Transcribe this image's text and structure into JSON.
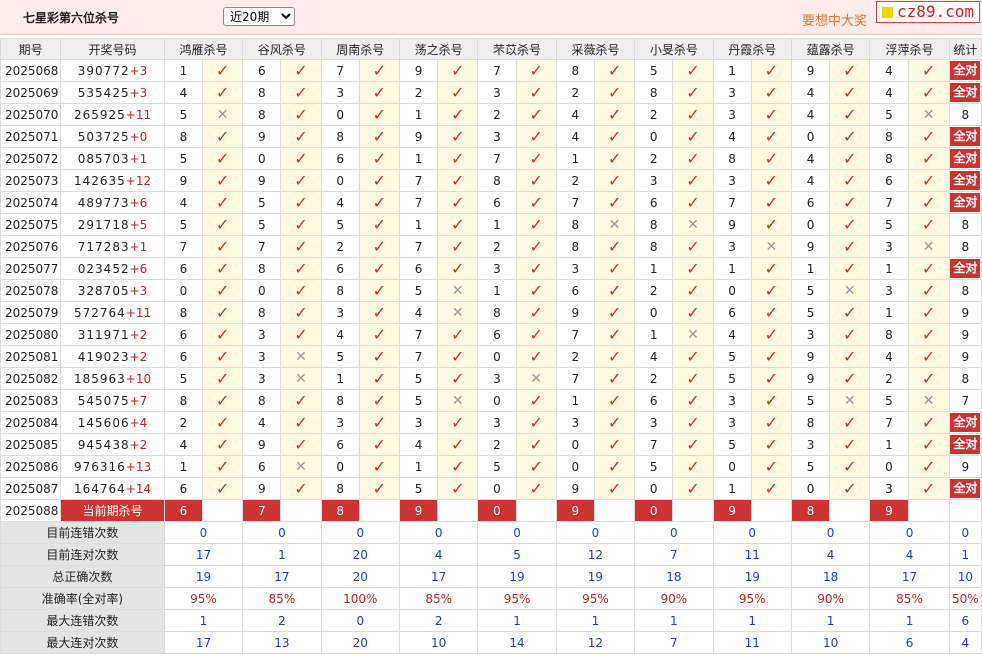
{
  "header": {
    "title": "七星彩第六位杀号",
    "period_select": "近20期",
    "slogan": "要想中大奖",
    "logo_text": "cz89.com"
  },
  "columns": {
    "period": "期号",
    "draw": "开奖号码",
    "experts": [
      "鸿雁杀号",
      "谷风杀号",
      "周南杀号",
      "荡之杀号",
      "芣苡杀号",
      "采薇杀号",
      "小旻杀号",
      "丹霞杀号",
      "蕴露杀号",
      "浮萍杀号"
    ],
    "stat": "统计"
  },
  "all_correct_label": "全对",
  "rows": [
    {
      "period": "2025068",
      "digits": "390772",
      "sum": "+3",
      "picks": [
        [
          1,
          1
        ],
        [
          6,
          1
        ],
        [
          7,
          1
        ],
        [
          9,
          1
        ],
        [
          7,
          1
        ],
        [
          8,
          1
        ],
        [
          5,
          1
        ],
        [
          1,
          1
        ],
        [
          9,
          1
        ],
        [
          4,
          1
        ]
      ],
      "stat": "全对"
    },
    {
      "period": "2025069",
      "digits": "535425",
      "sum": "+3",
      "picks": [
        [
          4,
          1
        ],
        [
          8,
          1
        ],
        [
          3,
          1
        ],
        [
          2,
          1
        ],
        [
          3,
          1
        ],
        [
          2,
          1
        ],
        [
          8,
          1
        ],
        [
          3,
          1
        ],
        [
          4,
          1
        ],
        [
          4,
          1
        ]
      ],
      "stat": "全对"
    },
    {
      "period": "2025070",
      "digits": "265925",
      "sum": "+11",
      "picks": [
        [
          5,
          0
        ],
        [
          8,
          1
        ],
        [
          0,
          1
        ],
        [
          1,
          1
        ],
        [
          2,
          1
        ],
        [
          4,
          1
        ],
        [
          2,
          1
        ],
        [
          3,
          1
        ],
        [
          4,
          1
        ],
        [
          5,
          0
        ]
      ],
      "stat": "8"
    },
    {
      "period": "2025071",
      "digits": "503725",
      "sum": "+0",
      "picks": [
        [
          8,
          1
        ],
        [
          9,
          1
        ],
        [
          8,
          1
        ],
        [
          9,
          1
        ],
        [
          3,
          1
        ],
        [
          4,
          1
        ],
        [
          0,
          1
        ],
        [
          4,
          1
        ],
        [
          0,
          1
        ],
        [
          8,
          1
        ]
      ],
      "stat": "全对"
    },
    {
      "period": "2025072",
      "digits": "085703",
      "sum": "+1",
      "picks": [
        [
          5,
          1
        ],
        [
          0,
          1
        ],
        [
          6,
          1
        ],
        [
          1,
          1
        ],
        [
          7,
          1
        ],
        [
          1,
          1
        ],
        [
          2,
          1
        ],
        [
          8,
          1
        ],
        [
          4,
          1
        ],
        [
          8,
          1
        ]
      ],
      "stat": "全对"
    },
    {
      "period": "2025073",
      "digits": "142635",
      "sum": "+12",
      "picks": [
        [
          9,
          1
        ],
        [
          9,
          1
        ],
        [
          0,
          1
        ],
        [
          7,
          1
        ],
        [
          8,
          1
        ],
        [
          2,
          1
        ],
        [
          3,
          1
        ],
        [
          3,
          1
        ],
        [
          4,
          1
        ],
        [
          6,
          1
        ]
      ],
      "stat": "全对"
    },
    {
      "period": "2025074",
      "digits": "489773",
      "sum": "+6",
      "picks": [
        [
          4,
          1
        ],
        [
          5,
          1
        ],
        [
          4,
          1
        ],
        [
          7,
          1
        ],
        [
          6,
          1
        ],
        [
          7,
          1
        ],
        [
          6,
          1
        ],
        [
          7,
          1
        ],
        [
          6,
          1
        ],
        [
          7,
          1
        ]
      ],
      "stat": "全对"
    },
    {
      "period": "2025075",
      "digits": "291718",
      "sum": "+5",
      "picks": [
        [
          5,
          1
        ],
        [
          5,
          1
        ],
        [
          5,
          1
        ],
        [
          1,
          1
        ],
        [
          1,
          1
        ],
        [
          8,
          0
        ],
        [
          8,
          0
        ],
        [
          9,
          1
        ],
        [
          0,
          1
        ],
        [
          5,
          1
        ]
      ],
      "stat": "8"
    },
    {
      "period": "2025076",
      "digits": "717283",
      "sum": "+1",
      "picks": [
        [
          7,
          1
        ],
        [
          7,
          1
        ],
        [
          2,
          1
        ],
        [
          7,
          1
        ],
        [
          2,
          1
        ],
        [
          8,
          1
        ],
        [
          8,
          1
        ],
        [
          3,
          0
        ],
        [
          9,
          1
        ],
        [
          3,
          0
        ]
      ],
      "stat": "8"
    },
    {
      "period": "2025077",
      "digits": "023452",
      "sum": "+6",
      "picks": [
        [
          6,
          1
        ],
        [
          8,
          1
        ],
        [
          6,
          1
        ],
        [
          6,
          1
        ],
        [
          3,
          1
        ],
        [
          3,
          1
        ],
        [
          1,
          1
        ],
        [
          1,
          1
        ],
        [
          1,
          1
        ],
        [
          1,
          1
        ]
      ],
      "stat": "全对"
    },
    {
      "period": "2025078",
      "digits": "328705",
      "sum": "+3",
      "picks": [
        [
          0,
          1
        ],
        [
          0,
          1
        ],
        [
          8,
          1
        ],
        [
          5,
          0
        ],
        [
          1,
          1
        ],
        [
          6,
          1
        ],
        [
          2,
          1
        ],
        [
          0,
          1
        ],
        [
          5,
          0
        ],
        [
          3,
          1
        ]
      ],
      "stat": "8"
    },
    {
      "period": "2025079",
      "digits": "572764",
      "sum": "+11",
      "picks": [
        [
          8,
          1
        ],
        [
          8,
          1
        ],
        [
          3,
          1
        ],
        [
          4,
          0
        ],
        [
          8,
          1
        ],
        [
          9,
          1
        ],
        [
          0,
          1
        ],
        [
          6,
          1
        ],
        [
          5,
          1
        ],
        [
          1,
          1
        ]
      ],
      "stat": "9"
    },
    {
      "period": "2025080",
      "digits": "311971",
      "sum": "+2",
      "picks": [
        [
          6,
          1
        ],
        [
          3,
          1
        ],
        [
          4,
          1
        ],
        [
          7,
          1
        ],
        [
          6,
          1
        ],
        [
          7,
          1
        ],
        [
          1,
          0
        ],
        [
          4,
          1
        ],
        [
          3,
          1
        ],
        [
          8,
          1
        ]
      ],
      "stat": "9"
    },
    {
      "period": "2025081",
      "digits": "419023",
      "sum": "+2",
      "picks": [
        [
          6,
          1
        ],
        [
          3,
          0
        ],
        [
          5,
          1
        ],
        [
          7,
          1
        ],
        [
          0,
          1
        ],
        [
          2,
          1
        ],
        [
          4,
          1
        ],
        [
          5,
          1
        ],
        [
          9,
          1
        ],
        [
          4,
          1
        ]
      ],
      "stat": "9"
    },
    {
      "period": "2025082",
      "digits": "185963",
      "sum": "+10",
      "picks": [
        [
          5,
          1
        ],
        [
          3,
          0
        ],
        [
          1,
          1
        ],
        [
          5,
          1
        ],
        [
          3,
          0
        ],
        [
          7,
          1
        ],
        [
          2,
          1
        ],
        [
          5,
          1
        ],
        [
          9,
          1
        ],
        [
          2,
          1
        ]
      ],
      "stat": "8"
    },
    {
      "period": "2025083",
      "digits": "545075",
      "sum": "+7",
      "picks": [
        [
          8,
          1
        ],
        [
          8,
          1
        ],
        [
          8,
          1
        ],
        [
          5,
          0
        ],
        [
          0,
          1
        ],
        [
          1,
          1
        ],
        [
          6,
          1
        ],
        [
          3,
          1
        ],
        [
          5,
          0
        ],
        [
          5,
          0
        ]
      ],
      "stat": "7"
    },
    {
      "period": "2025084",
      "digits": "145606",
      "sum": "+4",
      "picks": [
        [
          2,
          1
        ],
        [
          4,
          1
        ],
        [
          3,
          1
        ],
        [
          3,
          1
        ],
        [
          3,
          1
        ],
        [
          3,
          1
        ],
        [
          3,
          1
        ],
        [
          3,
          1
        ],
        [
          8,
          1
        ],
        [
          7,
          1
        ]
      ],
      "stat": "全对"
    },
    {
      "period": "2025085",
      "digits": "945438",
      "sum": "+2",
      "picks": [
        [
          4,
          1
        ],
        [
          9,
          1
        ],
        [
          6,
          1
        ],
        [
          4,
          1
        ],
        [
          2,
          1
        ],
        [
          0,
          1
        ],
        [
          7,
          1
        ],
        [
          5,
          1
        ],
        [
          3,
          1
        ],
        [
          1,
          1
        ]
      ],
      "stat": "全对"
    },
    {
      "period": "2025086",
      "digits": "976316",
      "sum": "+13",
      "picks": [
        [
          1,
          1
        ],
        [
          6,
          0
        ],
        [
          0,
          1
        ],
        [
          1,
          1
        ],
        [
          5,
          1
        ],
        [
          0,
          1
        ],
        [
          5,
          1
        ],
        [
          0,
          1
        ],
        [
          5,
          1
        ],
        [
          0,
          1
        ]
      ],
      "stat": "9"
    },
    {
      "period": "2025087",
      "digits": "164764",
      "sum": "+14",
      "picks": [
        [
          6,
          1
        ],
        [
          9,
          1
        ],
        [
          8,
          1
        ],
        [
          5,
          1
        ],
        [
          0,
          1
        ],
        [
          9,
          1
        ],
        [
          0,
          1
        ],
        [
          1,
          1
        ],
        [
          0,
          1
        ],
        [
          3,
          1
        ]
      ],
      "stat": "全对"
    }
  ],
  "current": {
    "period": "2025088",
    "label": "当前期杀号",
    "picks": [
      "6",
      "7",
      "8",
      "9",
      "0",
      "9",
      "0",
      "9",
      "8",
      "9"
    ]
  },
  "summary": [
    {
      "label": "目前连错次数",
      "color": "blue",
      "values": [
        "0",
        "0",
        "0",
        "0",
        "0",
        "0",
        "0",
        "0",
        "0",
        "0"
      ],
      "stat": "0"
    },
    {
      "label": "目前连对次数",
      "color": "blue",
      "values": [
        "17",
        "1",
        "20",
        "4",
        "5",
        "12",
        "7",
        "11",
        "4",
        "4"
      ],
      "stat": "1"
    },
    {
      "label": "总正确次数",
      "color": "blue",
      "values": [
        "19",
        "17",
        "20",
        "17",
        "19",
        "19",
        "18",
        "19",
        "18",
        "17"
      ],
      "stat": "10"
    },
    {
      "label": "准确率(全对率)",
      "color": "red",
      "values": [
        "95%",
        "85%",
        "100%",
        "85%",
        "95%",
        "95%",
        "90%",
        "95%",
        "90%",
        "85%"
      ],
      "stat": "50%"
    },
    {
      "label": "最大连错次数",
      "color": "blue",
      "values": [
        "1",
        "2",
        "0",
        "2",
        "1",
        "1",
        "1",
        "1",
        "1",
        "1"
      ],
      "stat": "6"
    },
    {
      "label": "最大连对次数",
      "color": "blue",
      "values": [
        "17",
        "13",
        "20",
        "10",
        "14",
        "12",
        "7",
        "11",
        "10",
        "6"
      ],
      "stat": "4"
    }
  ],
  "colors": {
    "accent_red": "#cc3333",
    "check_red": "#e02a2a",
    "summary_blue": "#1a3fd0",
    "mark_bg": "#fffae0",
    "header_bg": "#fcebe8"
  },
  "icons": {
    "correct": "check-icon",
    "wrong": "cross-icon"
  }
}
